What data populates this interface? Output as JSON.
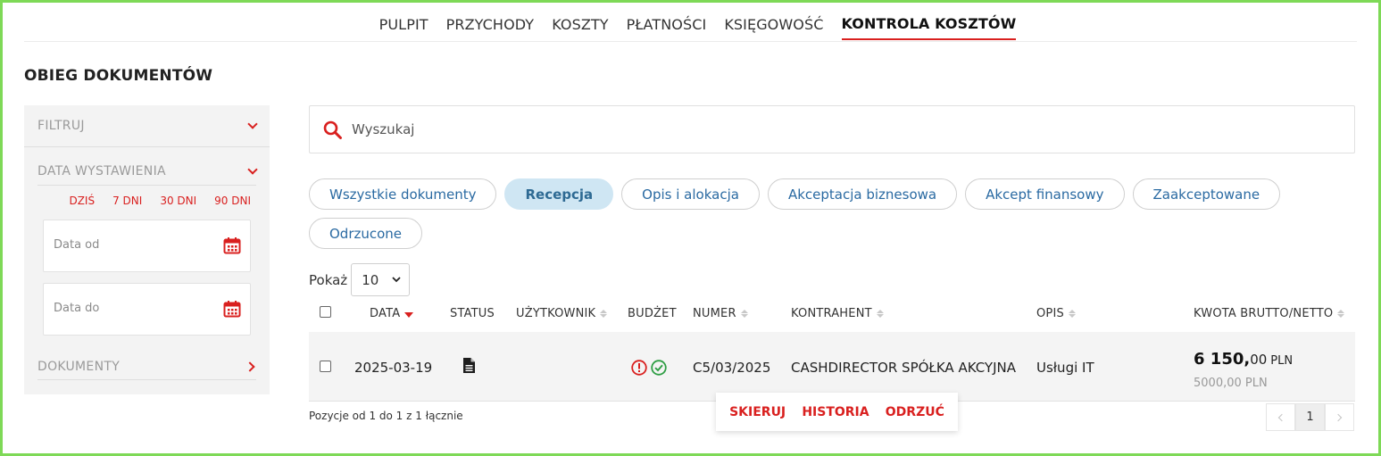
{
  "nav": {
    "items": [
      "PULPIT",
      "PRZYCHODY",
      "KOSZTY",
      "PŁATNOŚCI",
      "KSIĘGOWOŚĆ",
      "KONTROLA KOSZTÓW"
    ],
    "active_index": 5
  },
  "page_title": "OBIEG DOKUMENTÓW",
  "sidebar": {
    "filter_label": "FILTRUJ",
    "issue_date_label": "DATA WYSTAWIENIA",
    "quick_ranges": [
      "DZIŚ",
      "7 DNI",
      "30 DNI",
      "90 DNI"
    ],
    "date_from_placeholder": "Data od",
    "date_to_placeholder": "Data do",
    "documents_label": "DOKUMENTY"
  },
  "search": {
    "placeholder": "Wyszukaj"
  },
  "tabs": {
    "items": [
      "Wszystkie dokumenty",
      "Recepcja",
      "Opis i alokacja",
      "Akceptacja biznesowa",
      "Akcept finansowy",
      "Zaakceptowane",
      "Odrzucone"
    ],
    "active_index": 1
  },
  "page_size": {
    "label": "Pokaż",
    "value": "10"
  },
  "table": {
    "columns": [
      "DATA",
      "STATUS",
      "UŻYTKOWNIK",
      "BUDŻET",
      "NUMER",
      "KONTRAHENT",
      "OPIS",
      "KWOTA BRUTTO/NETTO"
    ],
    "sorted_column": "DATA",
    "rows": [
      {
        "date": "2025-03-19",
        "status_icon": "document-icon",
        "user": "",
        "budget_icons": [
          "warning-circle-icon",
          "check-circle-icon"
        ],
        "number": "C5/03/2025",
        "contractor": "CASHDIRECTOR SPÓŁKA AKCYJNA",
        "description": "Usługi IT",
        "gross_main": "6 150,",
        "gross_decimals": "00",
        "currency": "PLN",
        "net": "5000,00 PLN"
      }
    ]
  },
  "summary": "Pozycje od 1 do 1 z 1 łącznie",
  "row_actions": [
    "SKIERUJ",
    "HISTORIA",
    "ODRZUĆ"
  ],
  "pagination": {
    "current_page": "1"
  },
  "colors": {
    "accent_red": "#d9201f",
    "link_blue": "#2a6aa2",
    "active_chip_bg": "#cfe6f3",
    "frame_green": "#7ed957",
    "ok_green": "#2e9e44"
  }
}
